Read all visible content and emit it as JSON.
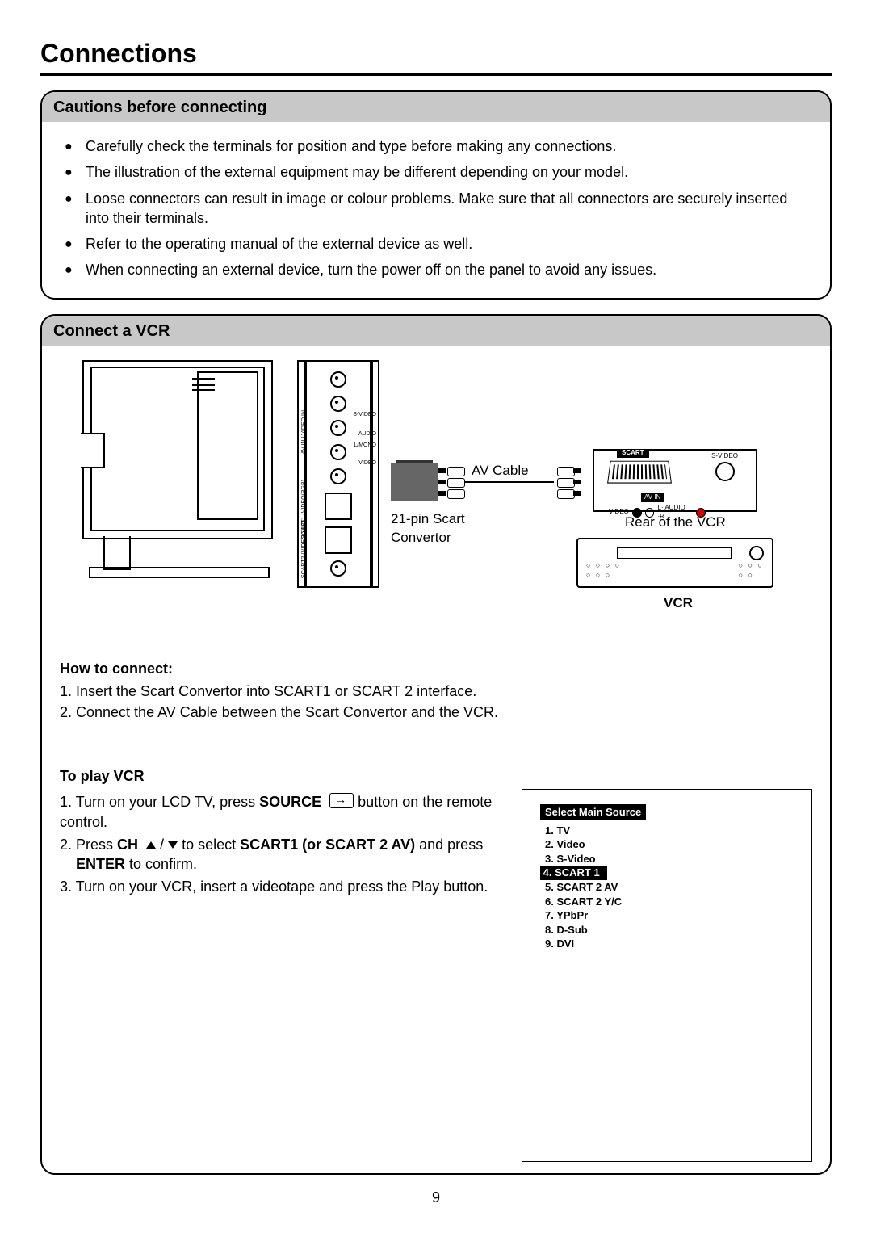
{
  "page_title": "Connections",
  "page_number": "9",
  "cautions": {
    "heading": "Cautions before connecting",
    "items": [
      "Carefully check the terminals for position and type before making any connections.",
      "The illustration of the external equipment may be different depending on your model.",
      "Loose connectors can result in image or colour problems. Make sure that all connectors are securely inserted into their terminals.",
      "Refer to the operating manual of the external device as well.",
      "When connecting an external device, turn the power off on the panel to avoid any issues."
    ]
  },
  "vcr": {
    "heading": "Connect a VCR",
    "diagram": {
      "av_cable": "AV Cable",
      "scart_conv": "21-pin Scart\nConvertor",
      "rear_label": "Rear of the VCR",
      "vcr_label": "VCR",
      "ports": {
        "svideo": "S-VIDEO",
        "audio": "AUDIO",
        "lmono": "L/MONO",
        "video": "VIDEO",
        "av_in": "AV IN",
        "av_in_video_in": "AV IN / VIDEO IN",
        "scart1": "SCART1 (VIDEO/RGB)",
        "scart2": "SCART2 (VIDEO Y&C)",
        "audio_lr": "L· AUDIO ·R",
        "scart": "SCART"
      }
    },
    "how_to": {
      "heading": "How to connect:",
      "step1": "1. Insert the Scart Convertor into SCART1 or SCART 2 interface.",
      "step2": "2. Connect the AV Cable between the Scart Convertor and the VCR."
    },
    "play": {
      "heading": "To play VCR",
      "step1_a": "1. Turn on your LCD TV, press ",
      "step1_b": "SOURCE",
      "step1_c": " button on the remote control.",
      "step2_a": "2. Press ",
      "step2_b": "CH",
      "step2_c": " to select ",
      "step2_d": "SCART1 (or SCART 2 AV)",
      "step2_e": " and press ",
      "step2_f": "ENTER",
      "step2_g": " to confirm.",
      "step3": "3. Turn on your VCR, insert a videotape and press the Play button."
    },
    "osd": {
      "title": "Select Main Source",
      "items": [
        "1. TV",
        "2. Video",
        "3. S-Video",
        "4. SCART 1",
        "5. SCART 2 AV",
        "6. SCART 2 Y/C",
        "7. YPbPr",
        "8. D-Sub",
        "9. DVI"
      ],
      "selected_index": 3
    }
  }
}
